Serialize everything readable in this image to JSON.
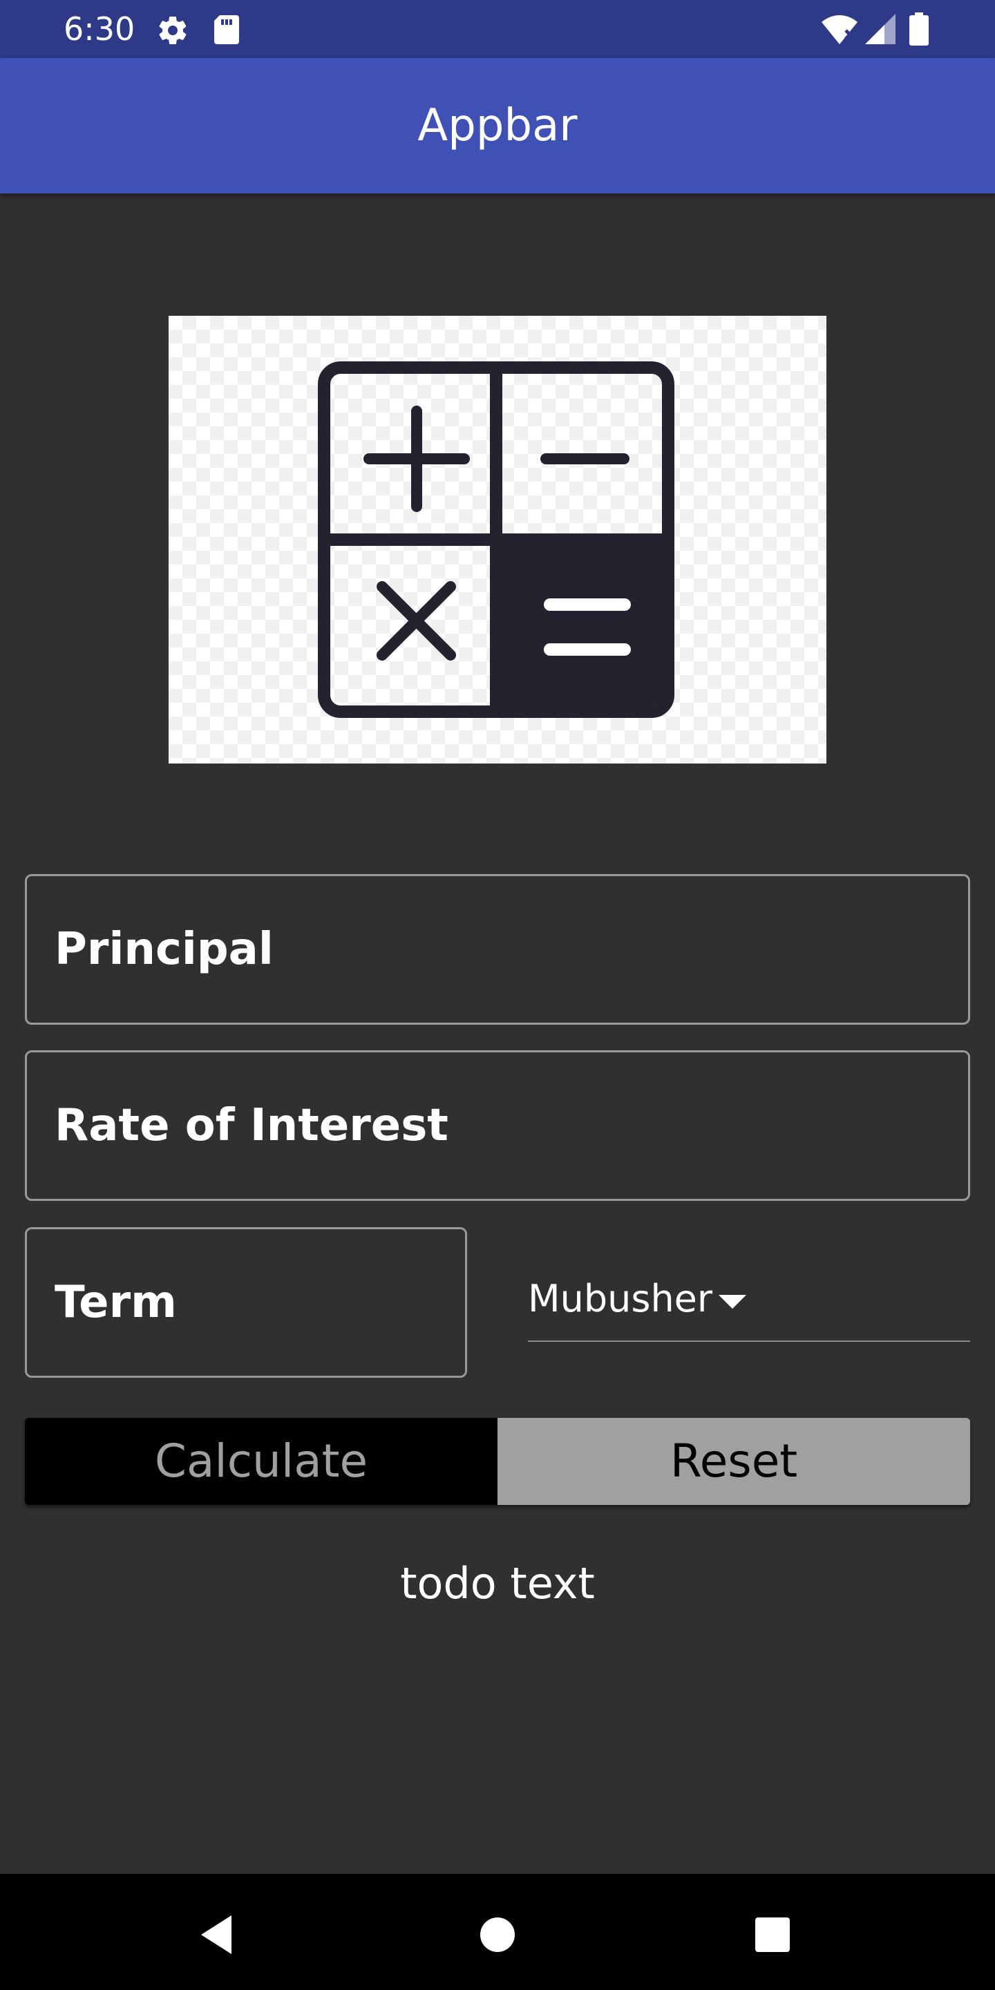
{
  "status_bar": {
    "time": "6:30",
    "icons": [
      "gear-icon",
      "sd-card-icon",
      "wifi-icon",
      "signal-icon",
      "battery-icon"
    ]
  },
  "app_bar": {
    "title": "Appbar"
  },
  "image": {
    "icon": "calculator-icon"
  },
  "form": {
    "principal_label": "Principal",
    "rate_label": "Rate of Interest",
    "term_label": "Term",
    "currency_selected": "Mubusher"
  },
  "buttons": {
    "calculate_label": "Calculate",
    "reset_label": "Reset"
  },
  "result": {
    "text": "todo text"
  },
  "nav_bar": {
    "icons": [
      "back-icon",
      "home-icon",
      "recents-icon"
    ]
  },
  "colors": {
    "status_bar": "#2e3a87",
    "app_bar": "#3f51b5",
    "background": "#303030",
    "calculate_bg": "#000000",
    "reset_bg": "#a0a0a0"
  }
}
